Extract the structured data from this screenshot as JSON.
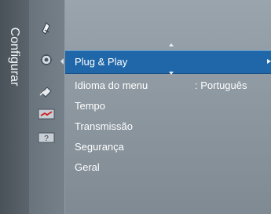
{
  "sidebar": {
    "title": "Configurar"
  },
  "icons": [
    {
      "name": "antenna-icon"
    },
    {
      "name": "settings-gear-icon"
    },
    {
      "name": "satellite-icon"
    },
    {
      "name": "input-icon"
    },
    {
      "name": "help-icon"
    }
  ],
  "menu": {
    "items": [
      {
        "label": "Plug & Play",
        "value": ""
      },
      {
        "label": "Idioma do menu",
        "value": ": Português"
      },
      {
        "label": "Tempo",
        "value": ""
      },
      {
        "label": "Transmissão",
        "value": ""
      },
      {
        "label": "Segurança",
        "value": ""
      },
      {
        "label": "Geral",
        "value": ""
      }
    ],
    "selected_index": 0
  },
  "colors": {
    "selected_row": "#1f67a9",
    "background": "#87939c",
    "sidebar": "#4a5259"
  }
}
